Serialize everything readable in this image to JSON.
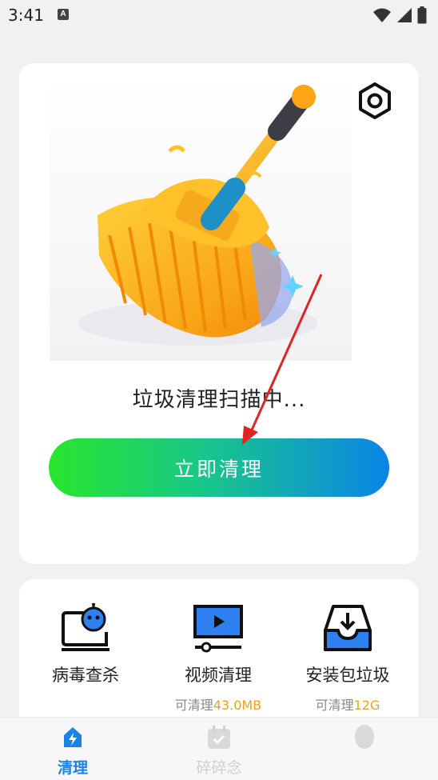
{
  "status_bar": {
    "time": "3:41",
    "notif_letter": "A"
  },
  "main": {
    "scan_status": "垃圾清理扫描中...",
    "clean_button": "立即清理"
  },
  "tools": [
    {
      "label": "病毒查杀",
      "icon": "virus-scan-icon"
    },
    {
      "label": "视频清理",
      "sub_prefix": "可清理",
      "sub_value": "43.0MB",
      "icon": "video-icon"
    },
    {
      "label": "安装包垃圾",
      "sub_prefix": "可清理",
      "sub_value": "12G",
      "icon": "package-icon"
    }
  ],
  "tabs": [
    {
      "label": "清理",
      "active": true,
      "icon": "clean-tab-icon"
    },
    {
      "label": "碎碎念",
      "active": false,
      "icon": "calendar-check-icon"
    },
    {
      "label": "",
      "active": false,
      "icon": "egg-icon"
    }
  ],
  "colors": {
    "accent": "#1a84e6",
    "button_gradient": [
      "#28e62c",
      "#19c789",
      "#0a85e8"
    ],
    "highlight": "#f0a21c",
    "arrow": "#e02424"
  }
}
